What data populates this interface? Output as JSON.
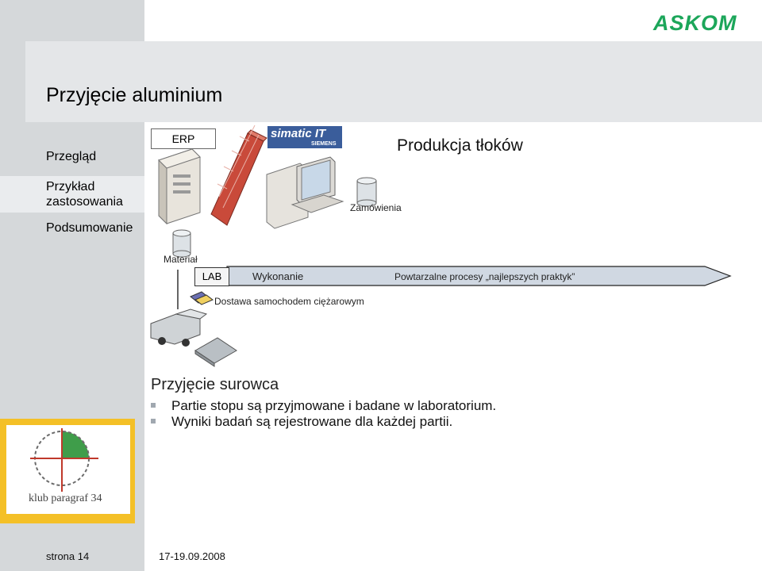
{
  "brand": {
    "logo": "ASKOM",
    "color": "#1ca65a"
  },
  "slide": {
    "title": "Przyjęcie aluminium"
  },
  "nav": [
    {
      "label": "Przegląd"
    },
    {
      "label": "Przykład zastosowania",
      "active": true
    },
    {
      "label": "Podsumowanie"
    }
  ],
  "diagram": {
    "erp": "ERP",
    "simatic": "simatic IT",
    "siemens": "SIEMENS",
    "heading": "Produkcja tłoków",
    "orders": "Zamówienia",
    "material": "Materiał",
    "lab": "LAB",
    "execution": "Wykonanie",
    "best_practices": "Powtarzalne procesy „najlepszych praktyk”",
    "delivery": "Dostawa samochodem ciężarowym"
  },
  "content": {
    "heading": "Przyjęcie surowca",
    "bullets": [
      "Partie stopu są przyjmowane i badane w laboratorium.",
      "Wyniki badań są rejestrowane dla każdej partii."
    ]
  },
  "club_logo": {
    "text": "klub paragraf 34"
  },
  "footer": {
    "page": "strona 14",
    "date": "17-19.09.2008"
  }
}
